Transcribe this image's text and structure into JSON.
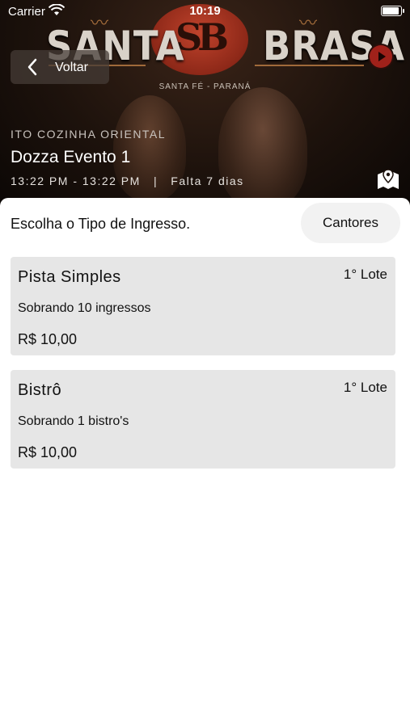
{
  "status_bar": {
    "carrier": "Carrier",
    "time": "10:19"
  },
  "banner": {
    "brand_left": "SANTA",
    "brand_right": "BRASA",
    "subtitle": "SANTA FÉ - PARANÁ"
  },
  "nav": {
    "back_label": "Voltar"
  },
  "event": {
    "venue": "ITO COZINHA ORIENTAL",
    "title": "Dozza Evento 1",
    "time_info": "13:22 PM - 13:22 PM   |   Falta 7 dias"
  },
  "content": {
    "heading": "Escolha o Tipo de Ingresso.",
    "singers_button": "Cantores"
  },
  "tickets": [
    {
      "name": "Pista Simples",
      "lot": "1° Lote",
      "remaining": "Sobrando 10 ingressos",
      "price": "R$ 10,00"
    },
    {
      "name": "Bistrô",
      "lot": "1° Lote",
      "remaining": "Sobrando 1 bistro's",
      "price": "R$ 10,00"
    }
  ],
  "icons": {
    "back": "chevron-left-icon",
    "map": "map-pin-icon",
    "play": "play-icon",
    "wifi": "wifi-icon",
    "battery": "battery-icon"
  },
  "colors": {
    "accent_red": "#a0211a",
    "card_bg": "#e6e6e6",
    "pill_bg": "#f2f2f2"
  }
}
